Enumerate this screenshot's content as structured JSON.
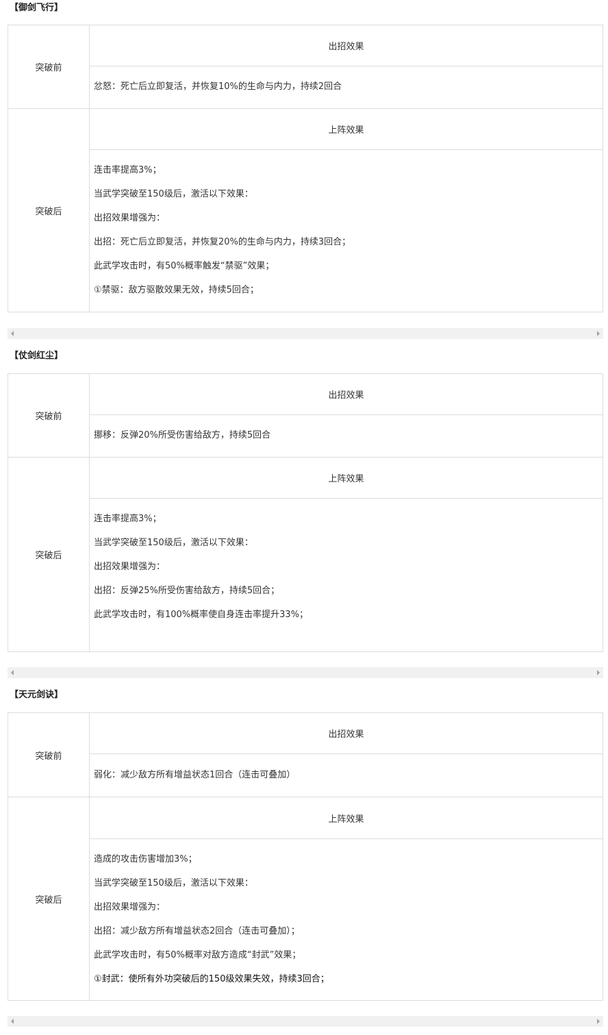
{
  "sections": [
    {
      "title": "【御剑飞行】",
      "before_label": "突破前",
      "before_header": "出招效果",
      "before_content": "忿怒：死亡后立即复活，并恢复10%的生命与内力，持续2回合",
      "after_label": "突破后",
      "after_header": "上阵效果",
      "after_lines": [
        "连击率提高3%；",
        "当武学突破至150级后，激活以下效果：",
        "出招效果增强为：",
        "出招：死亡后立即复活，并恢复20%的生命与内力，持续3回合；",
        "此武学攻击时，有50%概率触发“禁驱”效果；",
        "①禁驱：敌方驱散效果无效，持续5回合；"
      ]
    },
    {
      "title": "【仗剑红尘】",
      "before_label": "突破前",
      "before_header": "出招效果",
      "before_content": "挪移：反弹20%所受伤害给敌方，持续5回合",
      "after_label": "突破后",
      "after_header": "上阵效果",
      "after_lines": [
        "连击率提高3%；",
        "当武学突破至150级后，激活以下效果：",
        "出招效果增强为：",
        "出招：反弹25%所受伤害给敌方，持续5回合；",
        "此武学攻击时，有100%概率使自身连击率提升33%；"
      ]
    },
    {
      "title": "【天元剑诀】",
      "before_label": "突破前",
      "before_header": "出招效果",
      "before_content": "弱化：减少敌方所有增益状态1回合（连击可叠加）",
      "after_label": "突破后",
      "after_header": "上阵效果",
      "after_lines": [
        "造成的攻击伤害增加3%；",
        "当武学突破至150级后，激活以下效果：",
        "出招效果增强为：",
        "出招：减少敌方所有增益状态2回合（连击可叠加）；",
        "此武学攻击时，有50%概率对敌方造成“封武”效果；",
        "①封武：使所有外功突破后的150级效果失效，持续3回合；"
      ]
    }
  ]
}
